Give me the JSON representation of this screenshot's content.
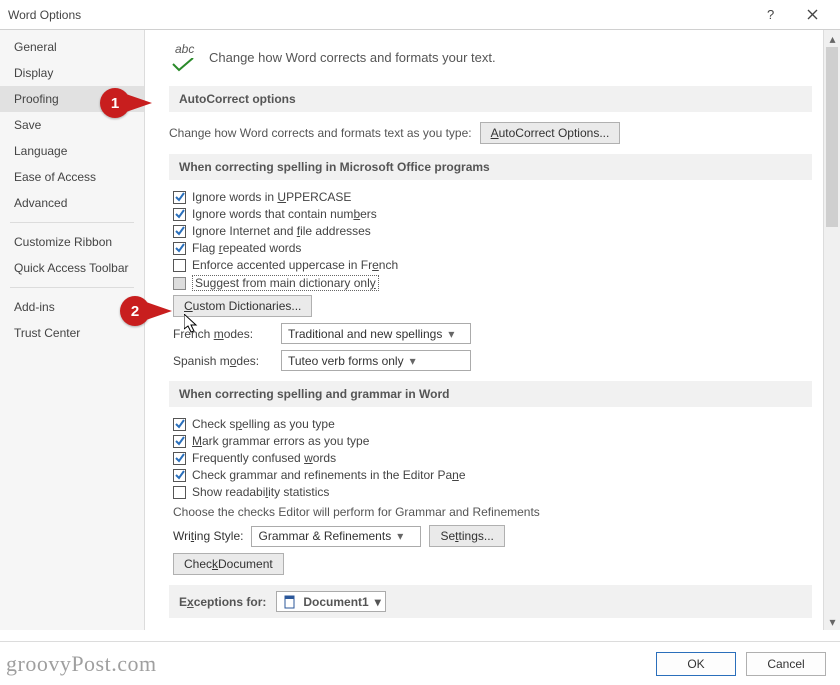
{
  "window": {
    "title": "Word Options"
  },
  "sidebar": {
    "items": [
      {
        "label": "General"
      },
      {
        "label": "Display"
      },
      {
        "label": "Proofing",
        "active": true
      },
      {
        "label": "Save"
      },
      {
        "label": "Language"
      },
      {
        "label": "Ease of Access"
      },
      {
        "label": "Advanced"
      }
    ],
    "items2": [
      {
        "label": "Customize Ribbon"
      },
      {
        "label": "Quick Access Toolbar"
      }
    ],
    "items3": [
      {
        "label": "Add-ins"
      },
      {
        "label": "Trust Center"
      }
    ]
  },
  "header": {
    "abc": "abc",
    "text": "Change how Word corrects and formats your text."
  },
  "autocorrect": {
    "heading": "AutoCorrect options",
    "text": "Change how Word corrects and formats text as you type:",
    "button": "AutoCorrect Options..."
  },
  "spelling_office": {
    "heading": "When correcting spelling in Microsoft Office programs",
    "checks": [
      {
        "label_pre": "Ignore words in ",
        "ul": "U",
        "label_post": "PPERCASE",
        "checked": true
      },
      {
        "label_pre": "Ignore words that contain num",
        "ul": "b",
        "label_post": "ers",
        "checked": true
      },
      {
        "label_pre": "Ignore Internet and ",
        "ul": "f",
        "label_post": "ile addresses",
        "checked": true
      },
      {
        "label_pre": "Flag ",
        "ul": "r",
        "label_post": "epeated words",
        "checked": true
      },
      {
        "label_pre": "Enforce accented uppercase in Fr",
        "ul": "e",
        "label_post": "nch",
        "checked": false
      },
      {
        "label_pre": "Suggest from main dictionary onl",
        "ul": "y",
        "label_post": "",
        "checked": "grey",
        "focused": true
      }
    ],
    "custom_dict_btn": "Custom Dictionaries...",
    "french_label_pre": "French ",
    "french_ul": "m",
    "french_label_post": "odes:",
    "french_value": "Traditional and new spellings",
    "spanish_label_pre": "Spanish m",
    "spanish_ul": "o",
    "spanish_label_post": "des:",
    "spanish_value": "Tuteo verb forms only"
  },
  "spelling_word": {
    "heading": "When correcting spelling and grammar in Word",
    "checks": [
      {
        "label_pre": "Check s",
        "ul": "p",
        "label_post": "elling as you type",
        "checked": true
      },
      {
        "label_pre": "",
        "ul": "M",
        "label_post": "ark grammar errors as you type",
        "checked": true
      },
      {
        "label_pre": "Frequently confused ",
        "ul": "w",
        "label_post": "ords",
        "checked": true
      },
      {
        "label_pre": "Check grammar and refinements in the Editor Pa",
        "ul": "n",
        "label_post": "e",
        "checked": true
      },
      {
        "label_pre": "Show readabi",
        "ul": "l",
        "label_post": "ity statistics",
        "checked": false
      }
    ],
    "choose_text": "Choose the checks Editor will perform for Grammar and Refinements",
    "writing_style_label_pre": "Wri",
    "writing_style_ul": "t",
    "writing_style_label_post": "ing Style:",
    "writing_style_value": "Grammar & Refinements",
    "settings_btn_pre": "Se",
    "settings_btn_ul": "t",
    "settings_btn_post": "tings...",
    "check_doc_btn_pre": "Chec",
    "check_doc_btn_ul": "k",
    "check_doc_btn_post": " Document"
  },
  "exceptions": {
    "heading_pre": "E",
    "heading_ul": "x",
    "heading_post": "ceptions for:",
    "doc_value": "Document1"
  },
  "footer": {
    "ok": "OK",
    "cancel": "Cancel"
  },
  "annotations": {
    "one": "1",
    "two": "2"
  },
  "watermark": "groovyPost.com"
}
